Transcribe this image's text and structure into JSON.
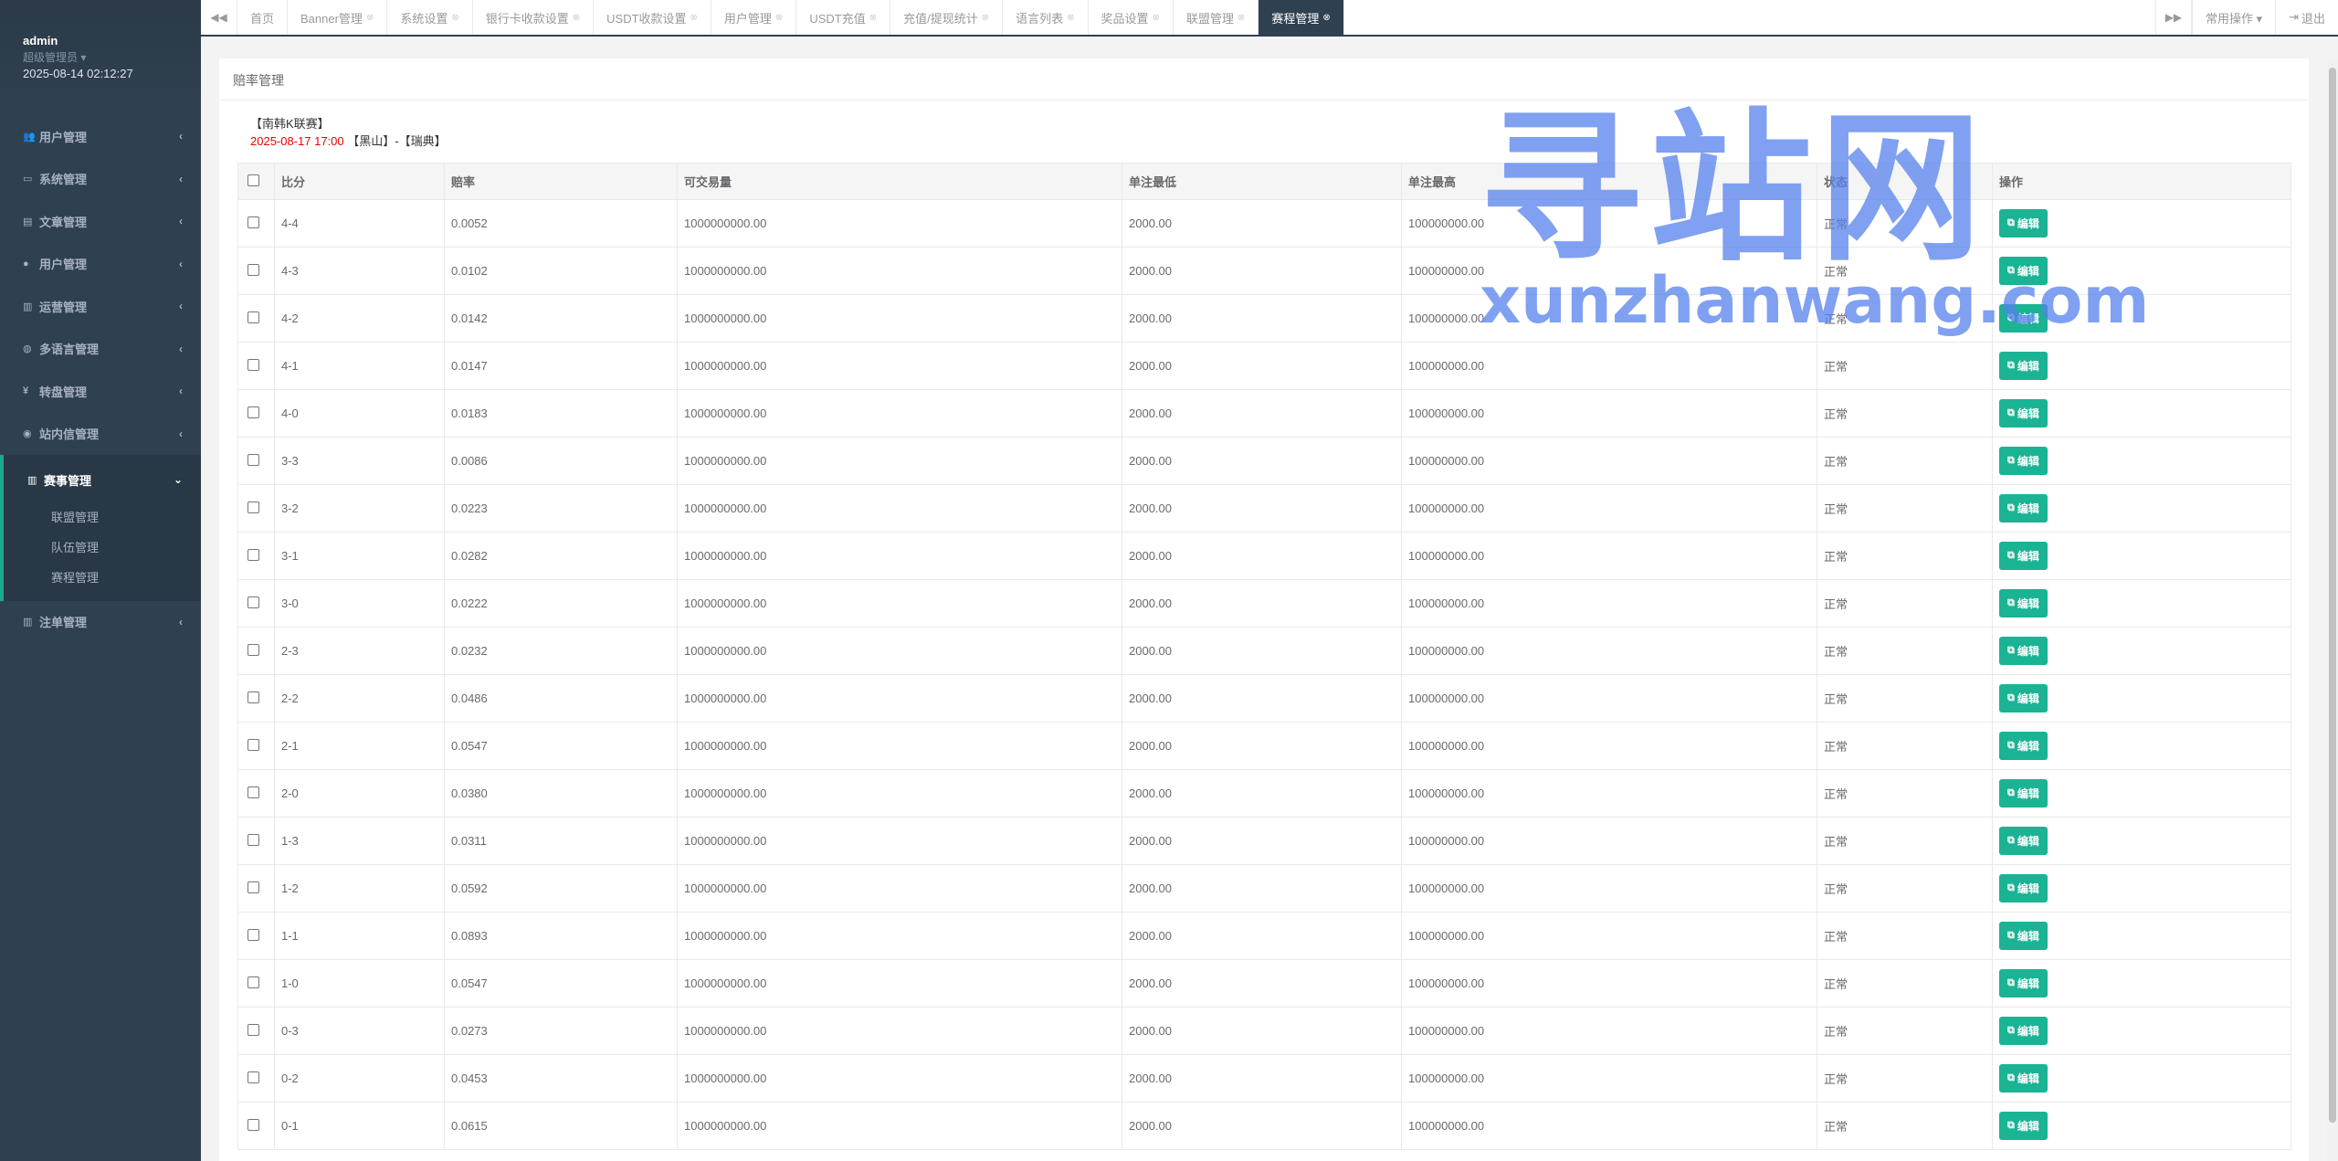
{
  "user": {
    "name": "admin",
    "role": "超级管理员 ▾",
    "datetime": "2025-08-14 02:12:27"
  },
  "sidebar": {
    "items": [
      {
        "label": "用户管理",
        "icon": "users-icon"
      },
      {
        "label": "系统管理",
        "icon": "desktop-icon"
      },
      {
        "label": "文章管理",
        "icon": "file-icon"
      },
      {
        "label": "用户管理",
        "icon": "user-icon"
      },
      {
        "label": "运营管理",
        "icon": "chart-icon"
      },
      {
        "label": "多语言管理",
        "icon": "globe-icon"
      },
      {
        "label": "转盘管理",
        "icon": "yen-icon"
      },
      {
        "label": "站内信管理",
        "icon": "comment-icon"
      }
    ],
    "active": {
      "label": "赛事管理",
      "icon": "bar-chart-icon",
      "children": [
        "联盟管理",
        "队伍管理",
        "赛程管理"
      ]
    },
    "last": {
      "label": "注单管理",
      "icon": "chart-icon"
    }
  },
  "tabs": [
    "首页",
    "Banner管理",
    "系统设置",
    "银行卡收款设置",
    "USDT收款设置",
    "用户管理",
    "USDT充值",
    "充值/提现统计",
    "语言列表",
    "奖品设置",
    "联盟管理",
    "赛程管理"
  ],
  "active_tab_index": 11,
  "toolbar": {
    "common_ops": "常用操作 ▾",
    "logout": "退出"
  },
  "panel": {
    "title": "赔率管理"
  },
  "match": {
    "league": "【南韩K联赛】",
    "datetime": "2025-08-17 17:00",
    "teams": "【黑山】-【瑞典】"
  },
  "table": {
    "headers": [
      "比分",
      "赔率",
      "可交易量",
      "单注最低",
      "单注最高",
      "状态",
      "操作"
    ],
    "edit_label": "编辑",
    "rows": [
      [
        "4-4",
        "0.0052",
        "1000000000.00",
        "2000.00",
        "100000000.00",
        "正常"
      ],
      [
        "4-3",
        "0.0102",
        "1000000000.00",
        "2000.00",
        "100000000.00",
        "正常"
      ],
      [
        "4-2",
        "0.0142",
        "1000000000.00",
        "2000.00",
        "100000000.00",
        "正常"
      ],
      [
        "4-1",
        "0.0147",
        "1000000000.00",
        "2000.00",
        "100000000.00",
        "正常"
      ],
      [
        "4-0",
        "0.0183",
        "1000000000.00",
        "2000.00",
        "100000000.00",
        "正常"
      ],
      [
        "3-3",
        "0.0086",
        "1000000000.00",
        "2000.00",
        "100000000.00",
        "正常"
      ],
      [
        "3-2",
        "0.0223",
        "1000000000.00",
        "2000.00",
        "100000000.00",
        "正常"
      ],
      [
        "3-1",
        "0.0282",
        "1000000000.00",
        "2000.00",
        "100000000.00",
        "正常"
      ],
      [
        "3-0",
        "0.0222",
        "1000000000.00",
        "2000.00",
        "100000000.00",
        "正常"
      ],
      [
        "2-3",
        "0.0232",
        "1000000000.00",
        "2000.00",
        "100000000.00",
        "正常"
      ],
      [
        "2-2",
        "0.0486",
        "1000000000.00",
        "2000.00",
        "100000000.00",
        "正常"
      ],
      [
        "2-1",
        "0.0547",
        "1000000000.00",
        "2000.00",
        "100000000.00",
        "正常"
      ],
      [
        "2-0",
        "0.0380",
        "1000000000.00",
        "2000.00",
        "100000000.00",
        "正常"
      ],
      [
        "1-3",
        "0.0311",
        "1000000000.00",
        "2000.00",
        "100000000.00",
        "正常"
      ],
      [
        "1-2",
        "0.0592",
        "1000000000.00",
        "2000.00",
        "100000000.00",
        "正常"
      ],
      [
        "1-1",
        "0.0893",
        "1000000000.00",
        "2000.00",
        "100000000.00",
        "正常"
      ],
      [
        "1-0",
        "0.0547",
        "1000000000.00",
        "2000.00",
        "100000000.00",
        "正常"
      ],
      [
        "0-3",
        "0.0273",
        "1000000000.00",
        "2000.00",
        "100000000.00",
        "正常"
      ],
      [
        "0-2",
        "0.0453",
        "1000000000.00",
        "2000.00",
        "100000000.00",
        "正常"
      ],
      [
        "0-1",
        "0.0615",
        "1000000000.00",
        "2000.00",
        "100000000.00",
        "正常"
      ]
    ]
  },
  "watermark": {
    "big": "寻站网",
    "small": "xunzhanwang.com"
  },
  "colors": {
    "sidebar": "#2f4050",
    "accent": "#1ab394",
    "date": "#ed0000",
    "watermark": "#5680ec"
  }
}
